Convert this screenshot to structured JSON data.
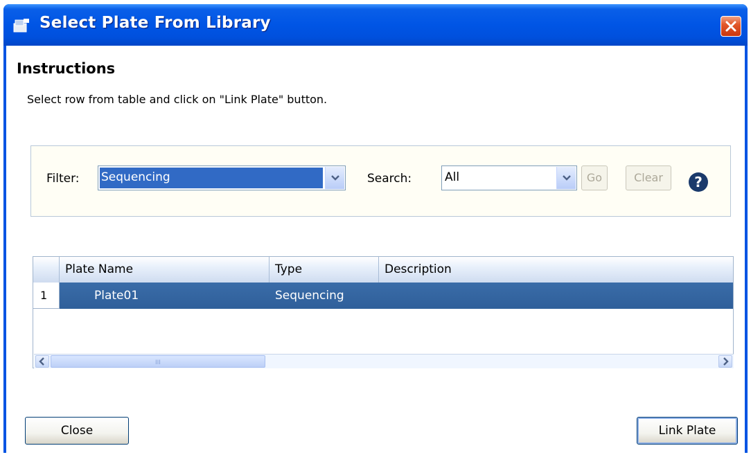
{
  "window": {
    "title": "Select Plate From Library"
  },
  "instructions": {
    "heading": "Instructions",
    "text": "Select row from table and click on \"Link Plate\" button."
  },
  "filter": {
    "filter_label": "Filter:",
    "filter_value": "Sequencing",
    "search_label": "Search:",
    "search_value": "All",
    "go_label": "Go",
    "clear_label": "Clear",
    "help_glyph": "?"
  },
  "table": {
    "columns": [
      "Plate Name",
      "Type",
      "Description"
    ],
    "rows": [
      {
        "num": "1",
        "plate_name": "Plate01",
        "type": "Sequencing",
        "description": ""
      }
    ],
    "scroll_grip": "III"
  },
  "buttons": {
    "close": "Close",
    "link": "Link Plate"
  },
  "colors": {
    "titlebar": "#0055e5",
    "selection": "#316ac5",
    "row_selected": "#3a6ca8"
  }
}
